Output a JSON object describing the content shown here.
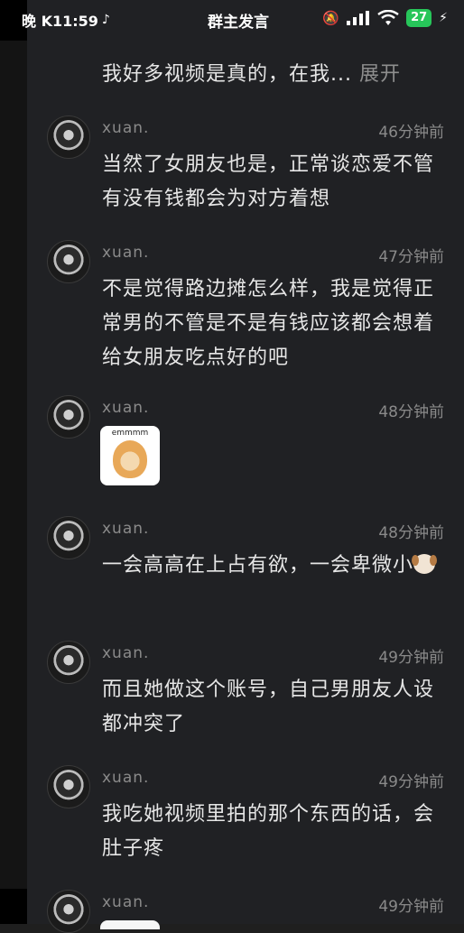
{
  "status_bar": {
    "left": "晚 K11:59",
    "title": "群主发言",
    "battery": "27"
  },
  "top_comment": {
    "text": "我好多视频是真的，在我...",
    "expand": "展开"
  },
  "comments": [
    {
      "user": "xuan.",
      "time": "46分钟前",
      "text": "当然了女朋友也是，正常谈恋爱不管有没有钱都会为对方着想"
    },
    {
      "user": "xuan.",
      "time": "47分钟前",
      "text": "不是觉得路边摊怎么样，我是觉得正常男的不管是不是有钱应该都会想着给女朋友吃点好的吧"
    },
    {
      "user": "xuan.",
      "time": "48分钟前",
      "sticker_label": "emmmm"
    },
    {
      "user": "xuan.",
      "time": "48分钟前",
      "text": "一会高高在上占有欲，一会卑微小"
    },
    {
      "user": "xuan.",
      "time": "49分钟前",
      "text": "而且她做这个账号，自己男朋友人设都冲突了"
    },
    {
      "user": "xuan.",
      "time": "49分钟前",
      "text": "我吃她视频里拍的那个东西的话，会肚子疼"
    },
    {
      "user": "xuan.",
      "time": "49分钟前"
    }
  ]
}
